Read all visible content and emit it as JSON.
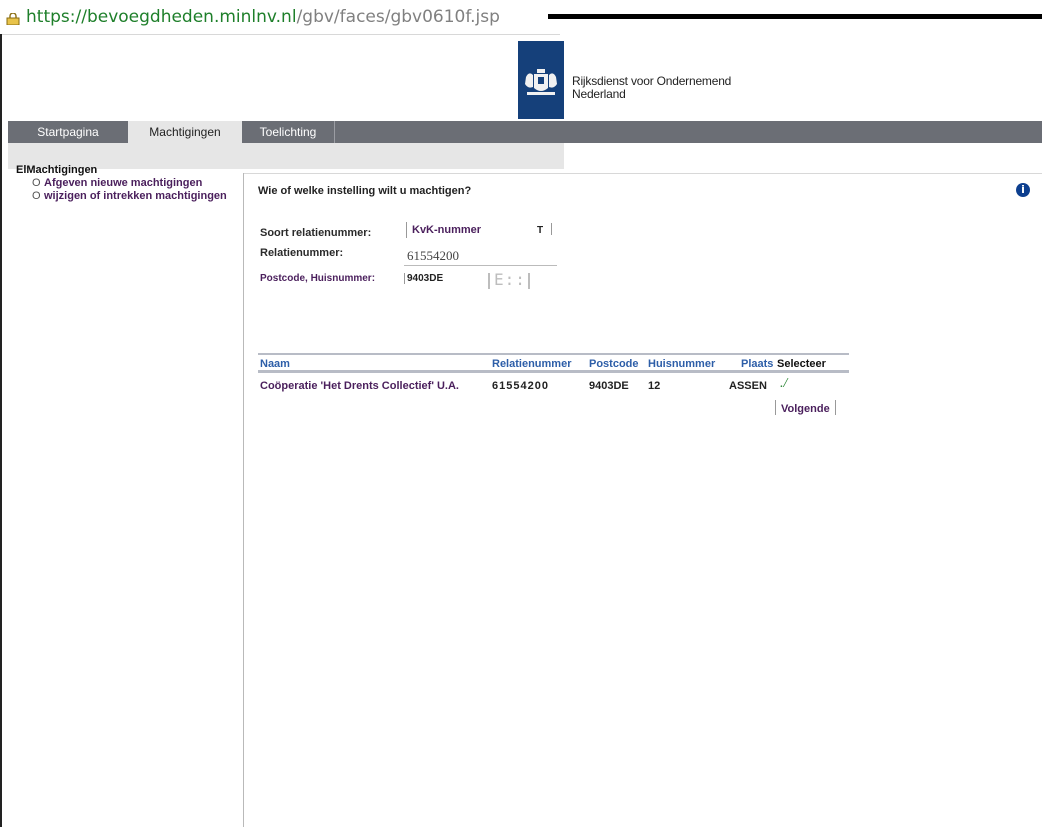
{
  "browser": {
    "url_scheme": "https://",
    "url_host": "bevoegdheden.minlnv.nl",
    "url_path": "/gbv/faces/gbv0610f.jsp"
  },
  "header": {
    "logo_line1": "Rijksdienst voor Ondernemend",
    "logo_line2": "Nederland"
  },
  "nav": {
    "tabs": [
      "Startpagina",
      "Machtigingen",
      "Toelichting"
    ],
    "active": "Machtigingen"
  },
  "sidebar": {
    "title": "ElMachtigingen",
    "items": [
      {
        "bullet": "O",
        "label": "Afgeven nieuwe machtigingen"
      },
      {
        "bullet": "O",
        "label": "wijzigen of intrekken machtigingen"
      }
    ]
  },
  "form": {
    "question": "Wie of welke instelling wilt u machtigen?",
    "soort_label": "Soort relatienummer:",
    "soort_value": "KvK-nummer",
    "soort_arrow": "T",
    "relatie_label": "Relatienummer:",
    "relatie_value": "61554200",
    "postcode_label": "Postcode, Huisnummer:",
    "postcode_value": "9403DE",
    "huisnummer_placeholder": "E::"
  },
  "info_icon": "info-icon",
  "table": {
    "headers": [
      "Naam",
      "Relatienummer",
      "Postcode",
      "Huisnummer",
      "Plaats",
      "Selecteer"
    ],
    "rows": [
      {
        "naam": "Coöperatie 'Het Drents Collectief' U.A.",
        "relatienummer": "61554200",
        "postcode": "9403DE",
        "huisnummer": "12",
        "plaats": "ASSEN",
        "selecteer": "./"
      }
    ]
  },
  "buttons": {
    "next": "Volgende"
  },
  "colors": {
    "nav_bg": "#6b6e75",
    "logo_blue": "#15407a",
    "link_purple": "#4a1f5c",
    "header_blue": "#2d5ea8",
    "url_green": "#1e7f2a"
  }
}
